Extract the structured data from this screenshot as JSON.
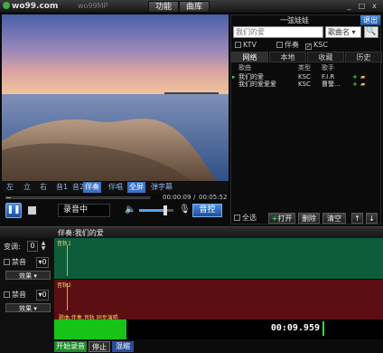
{
  "app": {
    "logo_text": "wo99.com",
    "faded_title": "wo99MP",
    "tab_function": "功能",
    "tab_library": "曲库",
    "win_min": "_",
    "win_max": "□",
    "win_close": "x"
  },
  "player": {
    "modes": [
      "左",
      "立",
      "右",
      "音1",
      "音2",
      "伴奏",
      "伴唱",
      "全屏",
      "弹字幕"
    ],
    "active_modes": [
      "伴奏",
      "全屏"
    ],
    "time_current": "00:00:09",
    "time_separator": "/",
    "time_total": "00:05:52",
    "playback_progress": 0.03,
    "status_text": "录音中",
    "volume": 0.75,
    "tone_button": "音控"
  },
  "user_panel": {
    "username": "一弦娃娃",
    "logout": "退出",
    "search_placeholder": "我们的爱",
    "search_type": "歌曲名",
    "search_button": "🔍",
    "checkboxes": [
      {
        "label": "KTV",
        "checked": false
      },
      {
        "label": "伴奏",
        "checked": false
      },
      {
        "label": "KSC",
        "checked": true
      }
    ],
    "tabs": [
      "网络",
      "本地",
      "收藏",
      "历史"
    ],
    "active_tab": "网络",
    "columns": [
      "歌曲",
      "类型",
      "歌手"
    ],
    "songs": [
      {
        "title": "我们的爱",
        "type": "KSC",
        "singer": "F.I.R"
      },
      {
        "title": "我们的爱爱爱",
        "type": "KSC",
        "singer": "曹警..."
      }
    ],
    "select_all": "全选",
    "open_button": "打开",
    "delete_button": "删除",
    "clear_button": "清空",
    "up_arrow": "↑",
    "down_arrow": "↓"
  },
  "recorder": {
    "accompaniment_label": "伴奏:我们的爱",
    "transpose_label": "变调:",
    "transpose_value": "0",
    "mute1_label": "禁音",
    "vol1_value": "0",
    "effect1": "效果",
    "mute2_label": "禁音",
    "vol2_value": "0",
    "effect2": "效果",
    "track1_label": "音轨1",
    "track2_label": "音轨2",
    "track_note": "歌曲,伴奏,音轨 同步演唱",
    "clock": "00:09.959",
    "start_recording": "开始录音",
    "stop": "停止",
    "mixdown": "混缩"
  },
  "colors": {
    "accent_blue": "#3b73c6",
    "track_green": "#0d5d3b",
    "track_red": "#5c0f12",
    "progress_green": "#16c316"
  }
}
